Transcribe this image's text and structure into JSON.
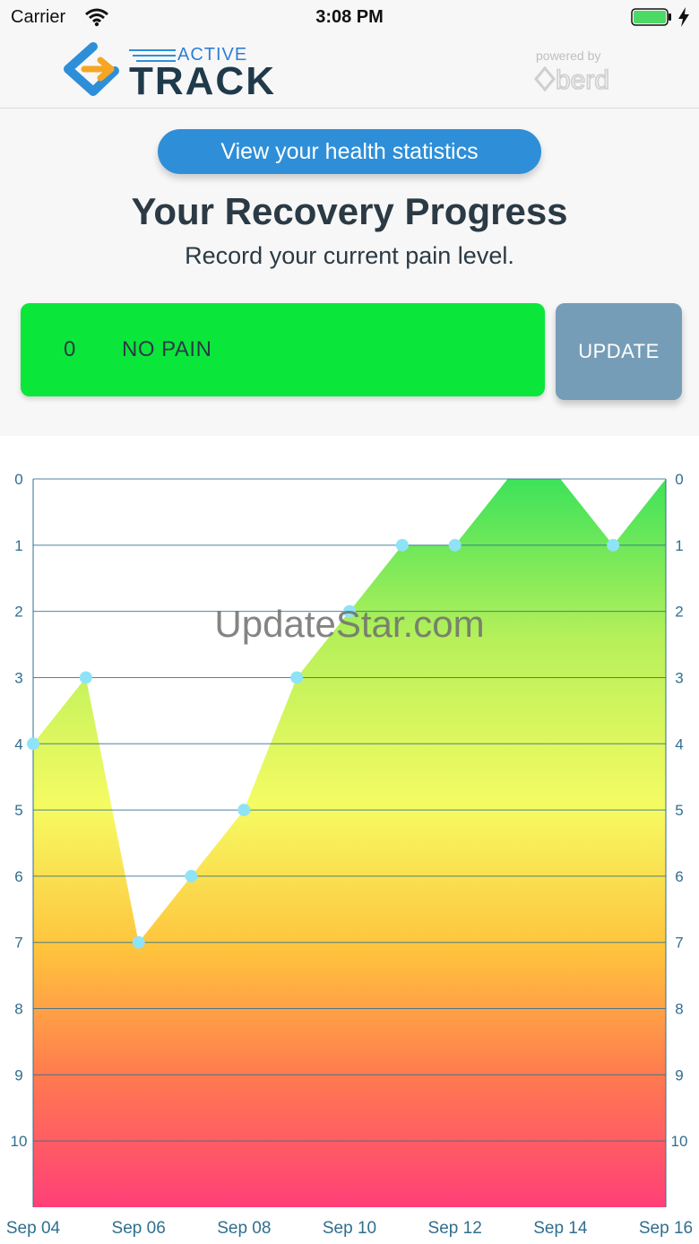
{
  "status_bar": {
    "carrier": "Carrier",
    "time": "3:08 PM"
  },
  "header": {
    "logo_active": "ACTIVE",
    "logo_track": "TRACK",
    "powered_by": "powered by"
  },
  "stats_button_label": "View your health statistics",
  "title": "Your Recovery Progress",
  "subtitle": "Record your current pain level.",
  "pain": {
    "value": "0",
    "label": "NO PAIN",
    "color": "#0be63b"
  },
  "update_label": "UPDATE",
  "watermark": "UpdateStar.com",
  "colors": {
    "accent": "#2e8fd8",
    "update": "#769db7",
    "point": "#8fe3f7",
    "grid": "#2f6f8f"
  },
  "chart_data": {
    "type": "area",
    "x_labels": [
      "Sep 04",
      "Sep 06",
      "Sep 08",
      "Sep 10",
      "Sep 12",
      "Sep 14",
      "Sep 16"
    ],
    "x_label_index": [
      0,
      2,
      4,
      6,
      8,
      10,
      12
    ],
    "values": [
      4,
      3,
      7,
      6,
      5,
      3,
      2,
      1,
      1,
      0,
      0,
      1,
      0
    ],
    "markers": [
      true,
      true,
      true,
      true,
      true,
      true,
      true,
      true,
      true,
      false,
      false,
      true,
      false
    ],
    "y_ticks": [
      0,
      1,
      2,
      3,
      4,
      5,
      6,
      7,
      8,
      9,
      10
    ],
    "ylim": [
      0,
      11
    ],
    "y_inverted": true,
    "grid": true
  }
}
